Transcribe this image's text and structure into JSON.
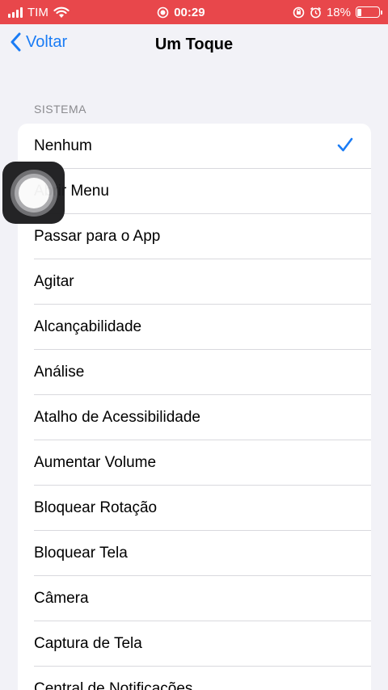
{
  "status_bar": {
    "carrier": "TIM",
    "time": "00:29",
    "battery": "18%",
    "battery_level": 0.18,
    "color": "#e8474b"
  },
  "nav": {
    "back_label": "Voltar",
    "title": "Um Toque"
  },
  "section": {
    "header": "SISTEMA",
    "items": [
      {
        "label": "Nenhum",
        "selected": true
      },
      {
        "label": "Abrir Menu"
      },
      {
        "label": "Passar para o App"
      },
      {
        "label": "Agitar"
      },
      {
        "label": "Alcançabilidade"
      },
      {
        "label": "Análise"
      },
      {
        "label": "Atalho de Acessibilidade"
      },
      {
        "label": "Aumentar Volume"
      },
      {
        "label": "Bloquear Rotação"
      },
      {
        "label": "Bloquear Tela"
      },
      {
        "label": "Câmera"
      },
      {
        "label": "Captura de Tela"
      },
      {
        "label": "Central de Notificações"
      }
    ]
  },
  "accent_color": "#1a7cf5",
  "icons": [
    "signal-icon",
    "wifi-icon",
    "recording-icon",
    "rotation-lock-icon",
    "alarm-icon",
    "battery-icon",
    "back-chevron-icon",
    "checkmark-icon",
    "assistive-touch-icon"
  ]
}
